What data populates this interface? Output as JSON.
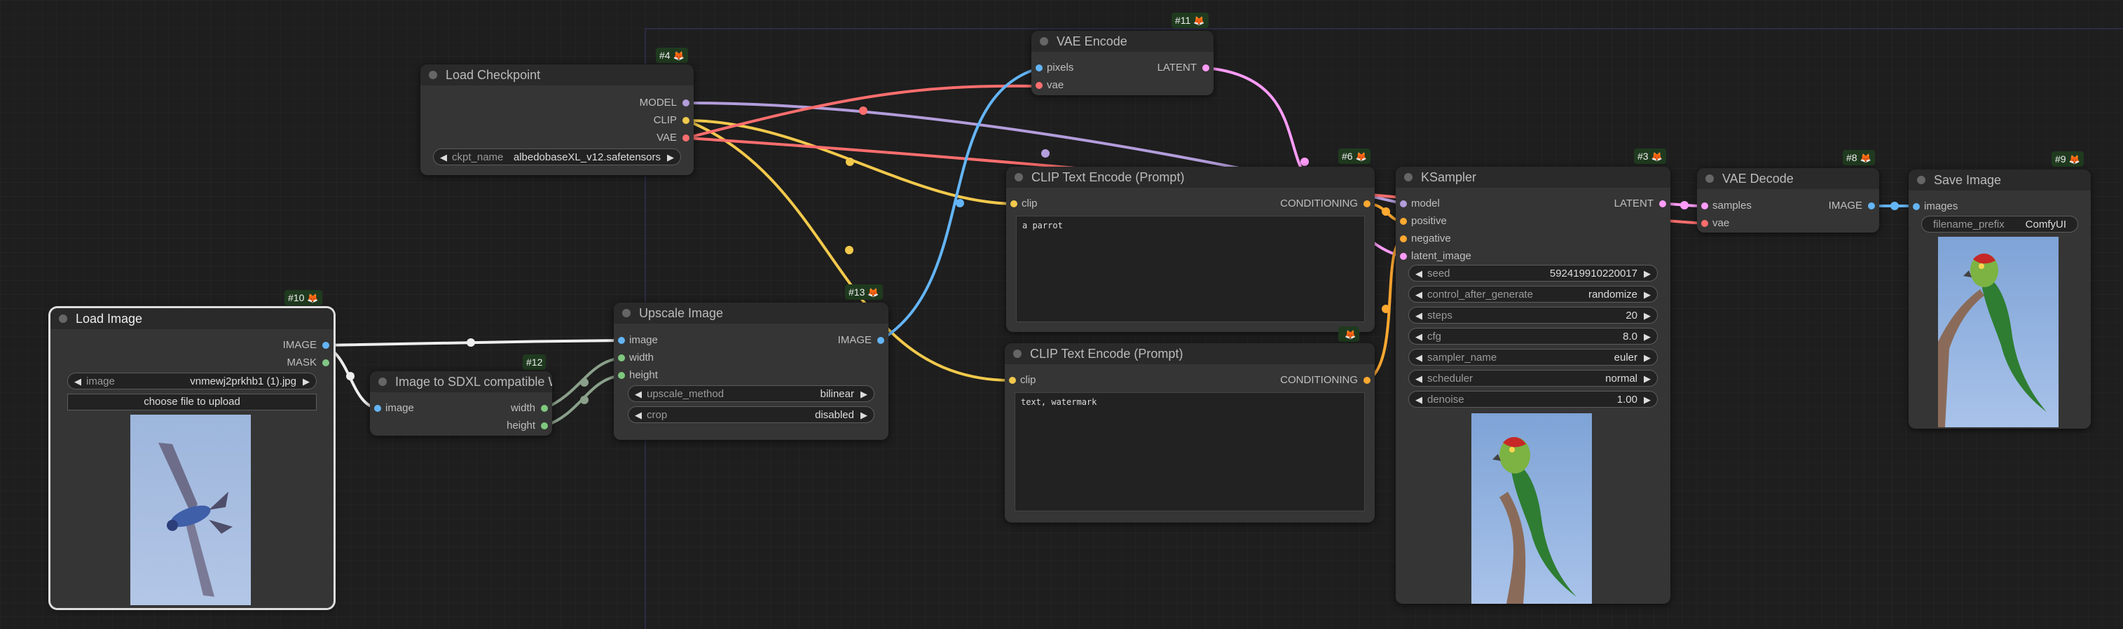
{
  "colors": {
    "background": "#1e1e1e",
    "node": "#353535",
    "title": "#2a2a2a",
    "MODEL": "#b39ddb",
    "CLIP": "#f2c94c",
    "VAE": "#ff6e6e",
    "LATENT": "#ff9cf9",
    "IMAGE": "#64b5f6",
    "MASK": "#81c784",
    "INT": "#7ec87e",
    "CONDITIONING": "#ffa931",
    "badge": "#1f3a1f"
  },
  "nodes": {
    "load_checkpoint": {
      "title": "Load Checkpoint",
      "badge": "#4",
      "outputs": [
        "MODEL",
        "CLIP",
        "VAE"
      ],
      "ckpt_label": "ckpt_name",
      "ckpt_value": "albedobaseXL_v12.safetensors"
    },
    "vae_encode": {
      "title": "VAE Encode",
      "badge": "#11",
      "inputs": [
        "pixels",
        "vae"
      ],
      "output": "LATENT"
    },
    "clip_pos": {
      "title": "CLIP Text Encode (Prompt)",
      "badge": "#6",
      "input": "clip",
      "output": "CONDITIONING",
      "text": "a parrot"
    },
    "clip_neg": {
      "title": "CLIP Text Encode (Prompt)",
      "input": "clip",
      "output": "CONDITIONING",
      "text": "text, watermark"
    },
    "ksampler": {
      "title": "KSampler",
      "badge": "#3",
      "inputs": [
        "model",
        "positive",
        "negative",
        "latent_image"
      ],
      "output": "LATENT",
      "widgets": [
        {
          "label": "seed",
          "value": "592419910220017"
        },
        {
          "label": "control_after_generate",
          "value": "randomize"
        },
        {
          "label": "steps",
          "value": "20"
        },
        {
          "label": "cfg",
          "value": "8.0"
        },
        {
          "label": "sampler_name",
          "value": "euler"
        },
        {
          "label": "scheduler",
          "value": "normal"
        },
        {
          "label": "denoise",
          "value": "1.00"
        }
      ]
    },
    "vae_decode": {
      "title": "VAE Decode",
      "badge": "#8",
      "inputs": [
        "samples",
        "vae"
      ],
      "output": "IMAGE"
    },
    "save_image": {
      "title": "Save Image",
      "badge": "#9",
      "input": "images",
      "prefix_label": "filename_prefix",
      "prefix_value": "ComfyUI"
    },
    "load_image": {
      "title": "Load Image",
      "badge": "#10",
      "outputs": [
        "IMAGE",
        "MASK"
      ],
      "image_label": "image",
      "image_value": "vnmewj2prkhb1 (1).jpg",
      "upload_label": "choose file to upload"
    },
    "sdxl_wh": {
      "title": "Image to SDXL compatible WH",
      "badge": "#12",
      "input": "image",
      "outputs": [
        "width",
        "height"
      ]
    },
    "upscale": {
      "title": "Upscale Image",
      "badge": "#13",
      "inputs": [
        "image",
        "width",
        "height"
      ],
      "output": "IMAGE",
      "widgets": [
        {
          "label": "upscale_method",
          "value": "bilinear"
        },
        {
          "label": "crop",
          "value": "disabled"
        }
      ]
    }
  }
}
